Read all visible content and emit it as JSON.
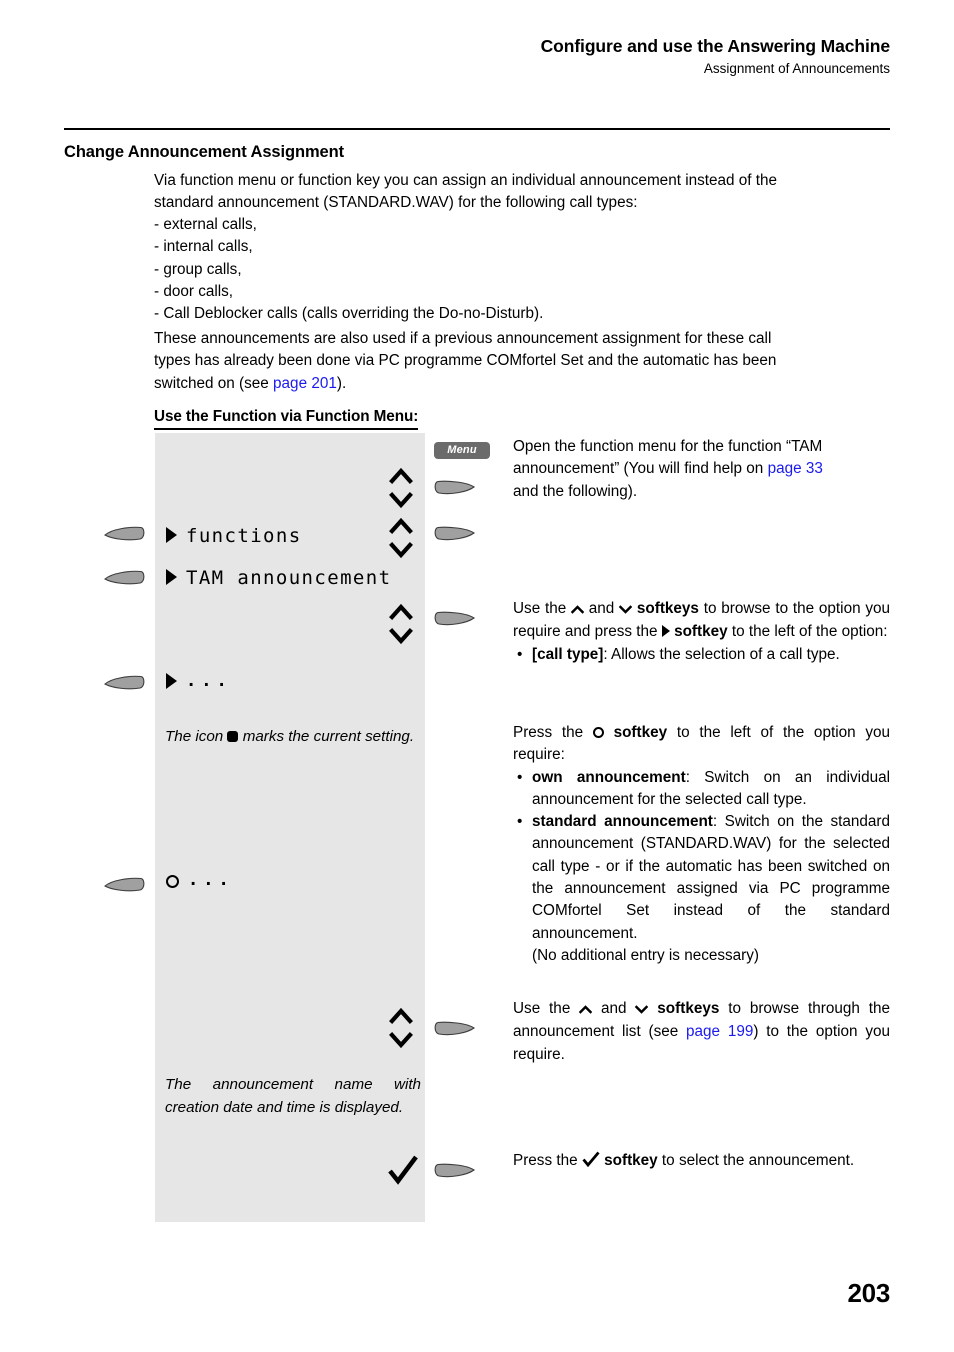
{
  "header": {
    "title": "Configure and use the Answering Machine",
    "subtitle": "Assignment of Announcements"
  },
  "section": {
    "heading": "Change Announcement Assignment",
    "intro_line1": "Via function menu or function key you can assign an individual announcement instead of the",
    "intro_line2": "standard announcement (STANDARD.WAV) for the following call types:",
    "call_types": [
      "- external calls,",
      "- internal calls,",
      "- group calls,",
      "- door calls,",
      "- Call Deblocker calls (calls overriding the Do-no-Disturb)."
    ],
    "second_para_line1": "These announcements are also used if a previous announcement assignment for these call",
    "second_para_line2": "types has already been done via PC programme COMfortel Set and the automatic has been",
    "second_para_line3_pre": "switched on (see ",
    "second_para_link": "page 201",
    "second_para_line3_post": ").",
    "subheading": "Use the Function via Function Menu:"
  },
  "display": {
    "menu_button_label": "Menu",
    "item_functions": "functions",
    "item_tam_announcement": "TAM announcement",
    "item_ellipsis": "...",
    "item_ellipsis_ring": "...",
    "note_current_setting_pre": "The icon ",
    "note_current_setting_post": " marks the current setting.",
    "note_announcement_name": "The announcement name with creation date and time is displayed."
  },
  "instructions": {
    "step1_line1": "Open the function menu for the function “TAM",
    "step1_line2_pre": "announcement” (You will find help on ",
    "step1_link": "page 33",
    "step1_line3": "and the following).",
    "step2_pre": "Use the ",
    "step2_mid": " and ",
    "step2_softkeys": "softkeys",
    "step2_browse": " to browse to the option you require and press the ",
    "step2_softkey": "softkey",
    "step2_post": " to the left of the option:",
    "bullet_call_type_label": "[call type]",
    "bullet_call_type_text": ": Allows the selection of a call type.",
    "step3_pre": "Press the ",
    "step3_softkey": "softkey",
    "step3_post": " to the left of the option you require:",
    "bullet_own_label": "own announcement",
    "bullet_own_text": ": Switch on an individual announcement for the selected call type.",
    "bullet_standard_label": "standard announcement",
    "bullet_standard_text": ": Switch on the standard announcement (STANDARD.WAV) for the selected call type - or if the automatic has been switched on the announcement assigned via PC programme COMfortel Set instead of the standard announcement.",
    "bullet_standard_note": "(No additional entry is necessary)",
    "step4_pre": "Use the ",
    "step4_mid": " and ",
    "step4_softkeys": "softkeys",
    "step4_browse": " to browse through the announcement list (see ",
    "step4_link": "page 199",
    "step4_post": ") to the option you require.",
    "step5_pre": "Press the ",
    "step5_softkey": "softkey",
    "step5_post": " to select the announcement."
  },
  "footer": {
    "page_number": "203"
  },
  "colors": {
    "link": "#1a1af0",
    "lcd_background": "#e6e6e6",
    "softkey_fill": "#a0a0a0",
    "menu_button": "#6b6b6b"
  }
}
